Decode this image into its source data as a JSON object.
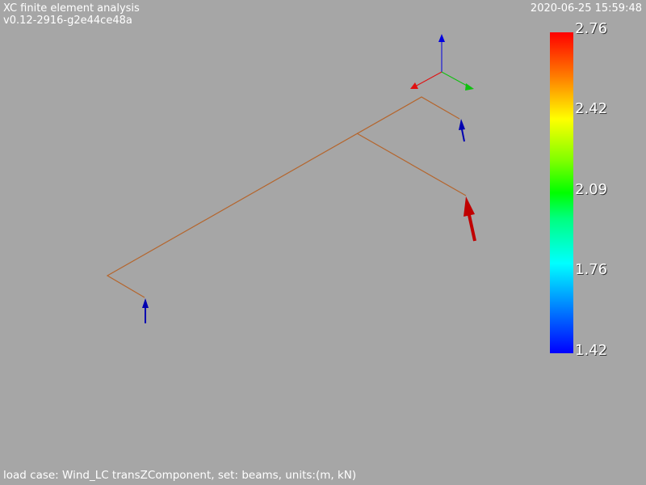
{
  "header": {
    "title": "XC finite element analysis",
    "version": "v0.12-2916-g2e44ce48a",
    "timestamp": "2020-06-25 15:59:48"
  },
  "footer": {
    "caption": "load case: Wind_LC transZComponent, set: beams, units:(m, kN)"
  },
  "colorbar": {
    "labels": [
      "2.76",
      "2.42",
      "2.09",
      "1.76",
      "1.42"
    ],
    "max": 2.76,
    "min": 1.42,
    "colormap": [
      "#ff0000",
      "#ffff00",
      "#00ff00",
      "#00ffff",
      "#0000ff"
    ]
  },
  "colors": {
    "background": "#a6a6a6",
    "beam": "#b5652c",
    "axis_x": "#e01010",
    "axis_y": "#10c010",
    "axis_z": "#0000e0",
    "reaction_high": "#c00000",
    "reaction_low": "#0000b0"
  }
}
